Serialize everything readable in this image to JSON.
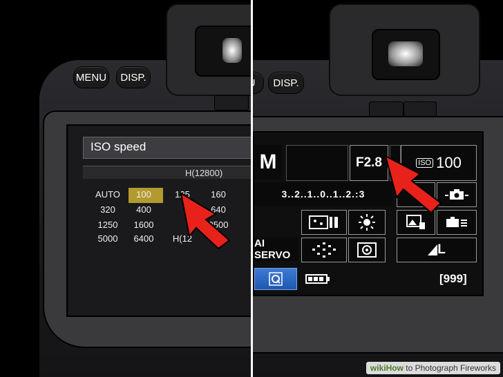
{
  "left": {
    "buttons": {
      "menu": "MENU",
      "disp": "DISP."
    },
    "iso_menu": {
      "title": "ISO speed",
      "max_label": "H(12800)",
      "selected": "100",
      "grid": [
        [
          "AUTO",
          "100",
          "125",
          "160"
        ],
        [
          "320",
          "400",
          "",
          "640"
        ],
        [
          "1250",
          "1600",
          "",
          "2500"
        ],
        [
          "5000",
          "6400",
          "H(12",
          ""
        ]
      ]
    }
  },
  "right": {
    "buttons": {
      "partial": "U",
      "disp": "DISP."
    },
    "quick_control": {
      "mode": "M",
      "aperture": "F2.8",
      "iso_label": "ISO",
      "iso_value": "100",
      "exposure_scale": "3..2..1..0..1..2.:3",
      "af_mode": "AI SERVO",
      "quality": "L",
      "shots_remaining": "[999]"
    }
  },
  "watermark": {
    "brand": "wiki",
    "how": "How",
    "rest": " to Photograph Fireworks"
  },
  "colors": {
    "highlight": "#b39a2e",
    "arrow": "#e8221a",
    "qc_border": "#9a9a9a"
  }
}
